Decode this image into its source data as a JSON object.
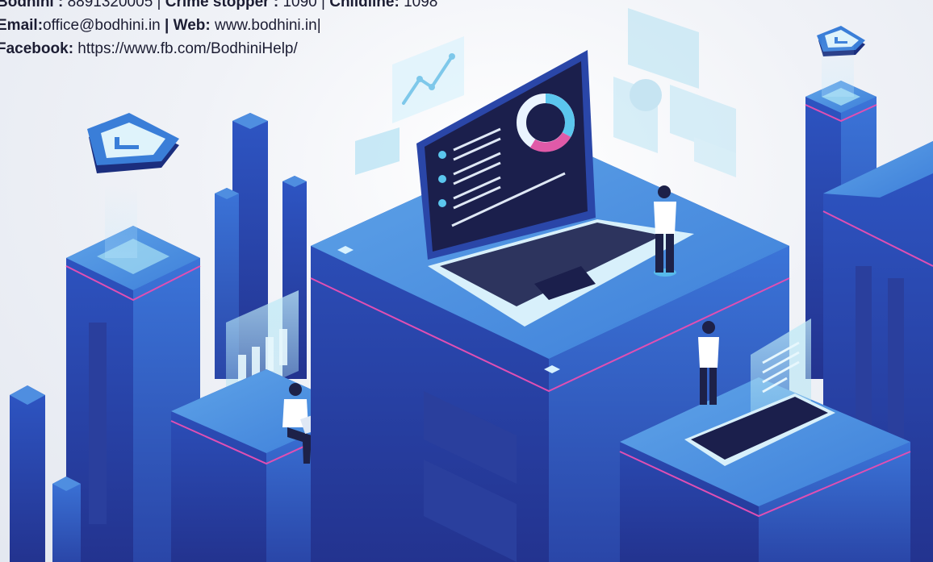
{
  "contact": {
    "line1": [
      {
        "label": "Bodhini :",
        "value": " 8891320005 | "
      },
      {
        "label": "Crime stopper :",
        "value": " 1090 | "
      },
      {
        "label": "Childline:",
        "value": " 1098"
      }
    ],
    "line2": [
      {
        "label": "Email:",
        "value": "office@bodhini.in "
      },
      {
        "label": "| Web:",
        "value": " www.bodhini.in|"
      }
    ],
    "line3": [
      {
        "label": "Facebook:",
        "value": " https://www.fb.com/BodhiniHelp/"
      }
    ]
  },
  "colors": {
    "primary_blue": "#2f5fc8",
    "dark_blue": "#1e2f8a",
    "light_cyan": "#a9e4f5",
    "magenta_accent": "#e04fb3",
    "background": "#eef0f5"
  },
  "illustration": {
    "icons": [
      "shield-badge-icon",
      "shield-badge-icon",
      "line-chart-icon",
      "donut-chart-icon",
      "bar-chart-icon"
    ]
  }
}
